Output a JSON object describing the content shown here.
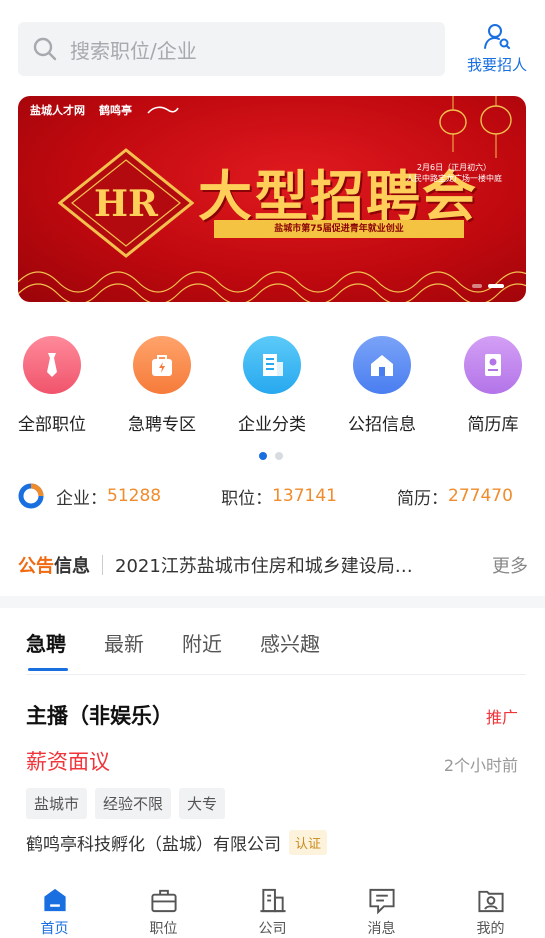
{
  "search": {
    "placeholder": "搜索职位/企业"
  },
  "recruit": {
    "label": "我要招人"
  },
  "banner": {
    "org1": "盐城人才网",
    "org2": "鹤鸣亭",
    "hr_logo": "HR",
    "title": "大型招聘会",
    "date_line1": "2月6日（正月初六）",
    "date_line2": "人民中路宝龙广场一楼中庭",
    "subtitle": "盐城市第75届促进青年就业创业"
  },
  "menu": [
    {
      "label": "全部职位",
      "icon": "tie-icon",
      "color": "#f0546c"
    },
    {
      "label": "急聘专区",
      "icon": "urgent-bag-icon",
      "color": "#f57b3a"
    },
    {
      "label": "企业分类",
      "icon": "building-icon",
      "color": "#27a8ef"
    },
    {
      "label": "公招信息",
      "icon": "home-icon",
      "color": "#4a7ef0"
    },
    {
      "label": "简历库",
      "icon": "resume-icon",
      "color": "#b374e8"
    }
  ],
  "stats": {
    "company_label": "企业：",
    "company_value": "51288",
    "job_label": "职位：",
    "job_value": "137141",
    "resume_label": "简历：",
    "resume_value": "277470"
  },
  "notice": {
    "tag_a": "公告",
    "tag_b": "信息",
    "text": "2021江苏盐城市住房和城乡建设局…",
    "more": "更多"
  },
  "tabs": [
    "急聘",
    "最新",
    "附近",
    "感兴趣"
  ],
  "job": {
    "title": "主播（非娱乐）",
    "promo": "推广",
    "salary": "薪资面议",
    "time": "2个小时前",
    "tags": [
      "盐城市",
      "经验不限",
      "大专"
    ],
    "company": "鹤鸣亭科技孵化（盐城）有限公司",
    "cert": "认证"
  },
  "nav": [
    {
      "label": "首页",
      "icon": "home-nav-icon",
      "active": true
    },
    {
      "label": "职位",
      "icon": "briefcase-icon",
      "active": false
    },
    {
      "label": "公司",
      "icon": "company-icon",
      "active": false
    },
    {
      "label": "消息",
      "icon": "message-icon",
      "active": false
    },
    {
      "label": "我的",
      "icon": "profile-icon",
      "active": false
    }
  ],
  "colors": {
    "accent": "#1a6fe0",
    "orange": "#f08c2c",
    "red": "#f0343a"
  }
}
